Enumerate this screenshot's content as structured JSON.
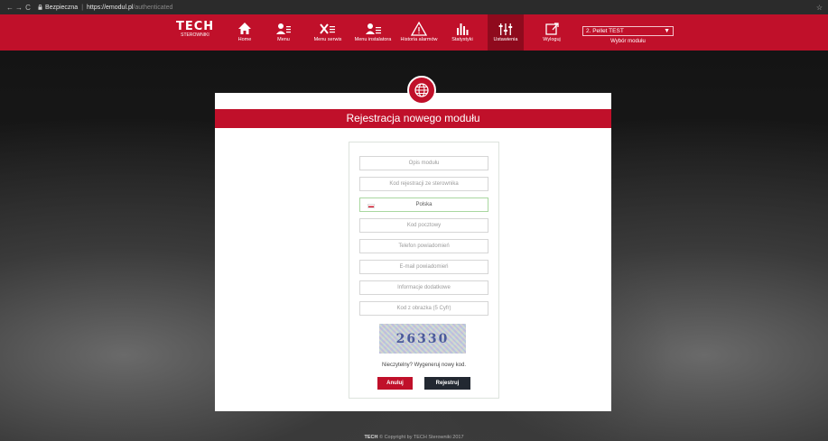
{
  "browser": {
    "back": "←",
    "forward": "→",
    "reload": "C",
    "secure_label": "Bezpieczna",
    "separator": "|",
    "url_host": "https://emodul.pl",
    "url_path": "/authenticated",
    "bookmark_star": "☆"
  },
  "header": {
    "logo_main": "TECH",
    "logo_sub": "STEROWNIKI",
    "nav": [
      {
        "label": "Home",
        "icon": "home-icon"
      },
      {
        "label": "Menu",
        "icon": "user-menu-icon"
      },
      {
        "label": "Menu serwis",
        "icon": "tools-icon"
      },
      {
        "label": "Menu instalatora",
        "icon": "installer-icon"
      },
      {
        "label": "Historia alarmów",
        "icon": "warning-icon"
      },
      {
        "label": "Statystyki",
        "icon": "bar-chart-icon"
      },
      {
        "label": "Ustawienia",
        "icon": "sliders-icon",
        "active": true
      },
      {
        "label": "Wyloguj",
        "icon": "logout-icon"
      }
    ],
    "module_select": {
      "value": "2. Pellet TEST",
      "caption": "Wybór modułu"
    }
  },
  "panel": {
    "title": "Rejestracja nowego modułu",
    "fields": [
      {
        "placeholder": "Opis modułu"
      },
      {
        "placeholder": "Kod rejestracji ze sterownika"
      },
      {
        "value": "Polska"
      },
      {
        "placeholder": "Kod pocztowy"
      },
      {
        "placeholder": "Telefon powiadomień"
      },
      {
        "placeholder": "E-mail powiadomień"
      },
      {
        "placeholder": "Informacje dodatkowe"
      },
      {
        "placeholder": "Kod z obrazka (5 Cyfr)"
      }
    ],
    "captcha_text": "26330",
    "refresh_text": "Nieczytelny? Wygeneruj nowy kod.",
    "cancel_label": "Anuluj",
    "register_label": "Rejestruj"
  },
  "footer": {
    "brand": "TECH",
    "copyright": "© Copyright by TECH Sterowniki 2017"
  },
  "colors": {
    "brand_red": "#c0102a",
    "dark_button": "#222831"
  }
}
